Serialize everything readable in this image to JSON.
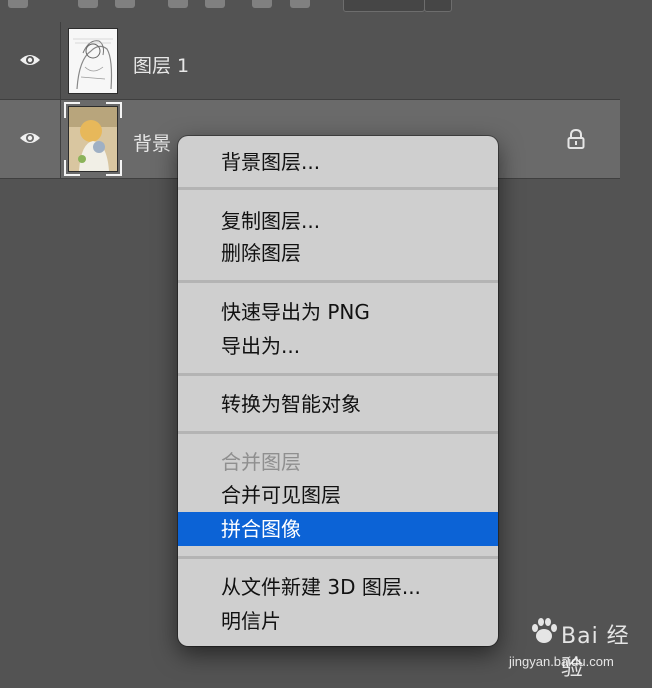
{
  "layers": [
    {
      "name": "图层 1",
      "visible": true,
      "selected": false,
      "locked": false
    },
    {
      "name": "背景",
      "visible": true,
      "selected": true,
      "locked": true
    }
  ],
  "context_menu": {
    "items": [
      {
        "label": "背景图层...",
        "enabled": true
      },
      {
        "label": "复制图层...",
        "enabled": true
      },
      {
        "label": "删除图层",
        "enabled": true
      },
      {
        "label": "快速导出为 PNG",
        "enabled": true
      },
      {
        "label": "导出为...",
        "enabled": true
      },
      {
        "label": "转换为智能对象",
        "enabled": true
      },
      {
        "label": "合并图层",
        "enabled": false
      },
      {
        "label": "合并可见图层",
        "enabled": true
      },
      {
        "label": "拼合图像",
        "enabled": true,
        "highlighted": true
      },
      {
        "label": "从文件新建 3D 图层...",
        "enabled": true
      },
      {
        "label": "明信片",
        "enabled": true
      }
    ]
  },
  "watermark": {
    "brand": "Bai 经验",
    "url": "jingyan.baidu.com"
  },
  "colors": {
    "panel_bg": "#535353",
    "selected_row_bg": "#6a6a6a",
    "menu_bg": "#cfcfcf",
    "highlight": "#0c63d6"
  }
}
